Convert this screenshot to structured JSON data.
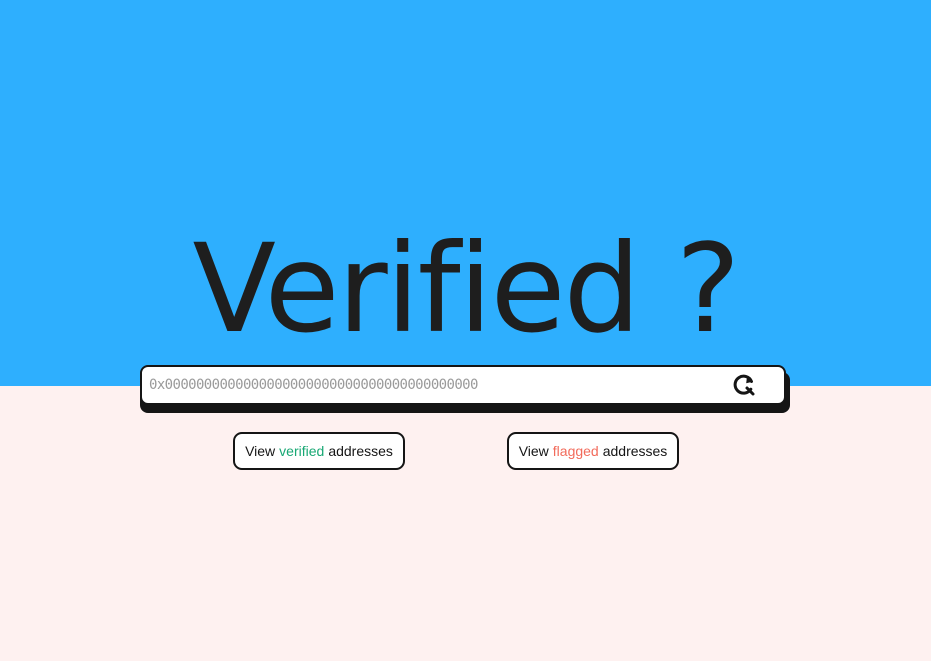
{
  "hero": {
    "title": "Verified ?"
  },
  "search": {
    "placeholder": "0x0000000000000000000000000000000000000000",
    "button_icon": "search-refresh-icon"
  },
  "links": {
    "verified": {
      "prefix": "View",
      "accent": "verified",
      "suffix": "addresses",
      "accent_color": "#18a874"
    },
    "flagged": {
      "prefix": "View",
      "accent": "flagged",
      "suffix": "addresses",
      "accent_color": "#f26b5b"
    }
  },
  "colors": {
    "top_background": "#2eaffe",
    "bottom_background": "#fef1f0",
    "text_dark": "#1e1e1e"
  }
}
